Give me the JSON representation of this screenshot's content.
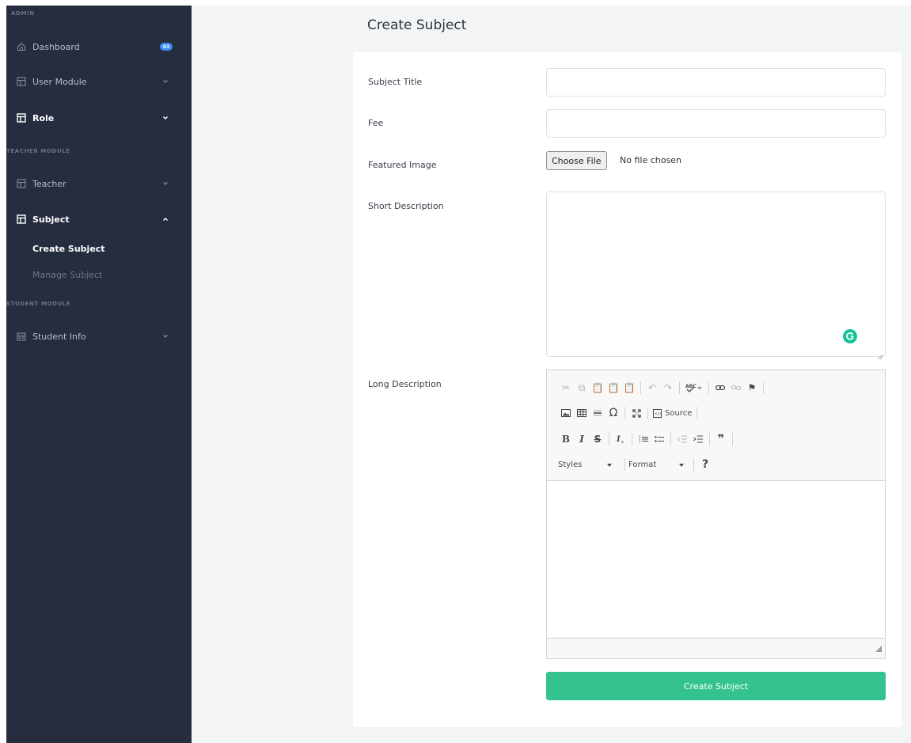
{
  "sidebar": {
    "sections": [
      {
        "heading": "ADMIN"
      },
      {
        "heading": "TEACHER MODULE"
      },
      {
        "heading": "STUDENT MODULE"
      }
    ],
    "items": {
      "dashboard": {
        "label": "Dashboard",
        "badge": "03",
        "icon": "home-icon"
      },
      "user_module": {
        "label": "User Module",
        "icon": "layout-icon"
      },
      "role": {
        "label": "Role",
        "icon": "layout-icon"
      },
      "teacher": {
        "label": "Teacher",
        "icon": "layout-icon"
      },
      "subject": {
        "label": "Subject",
        "icon": "layout-icon"
      },
      "create_subject": {
        "label": "Create Subject"
      },
      "manage_subject": {
        "label": "Manage Subject"
      },
      "student_info": {
        "label": "Student Info",
        "icon": "building-icon"
      }
    }
  },
  "page": {
    "title": "Create Subject"
  },
  "form": {
    "subject_title": {
      "label": "Subject Title",
      "value": "",
      "placeholder": ""
    },
    "fee": {
      "label": "Fee",
      "value": "",
      "placeholder": ""
    },
    "featured_image": {
      "label": "Featured Image",
      "button": "Choose File",
      "status": "No file chosen"
    },
    "short_description": {
      "label": "Short Description",
      "value": ""
    },
    "long_description": {
      "label": "Long Description"
    },
    "submit_label": "Create Subject"
  },
  "editor": {
    "source_label": "Source",
    "styles_label": "Styles",
    "format_label": "Format",
    "help_label": "?",
    "bold_label": "B",
    "italic_label": "I",
    "strike_label": "S",
    "omega_label": "Ω",
    "quote_label": "❞"
  },
  "colors": {
    "sidebar_bg": "#262d3f",
    "accent_green": "#34c38f",
    "badge_blue": "#3f8ef5"
  }
}
